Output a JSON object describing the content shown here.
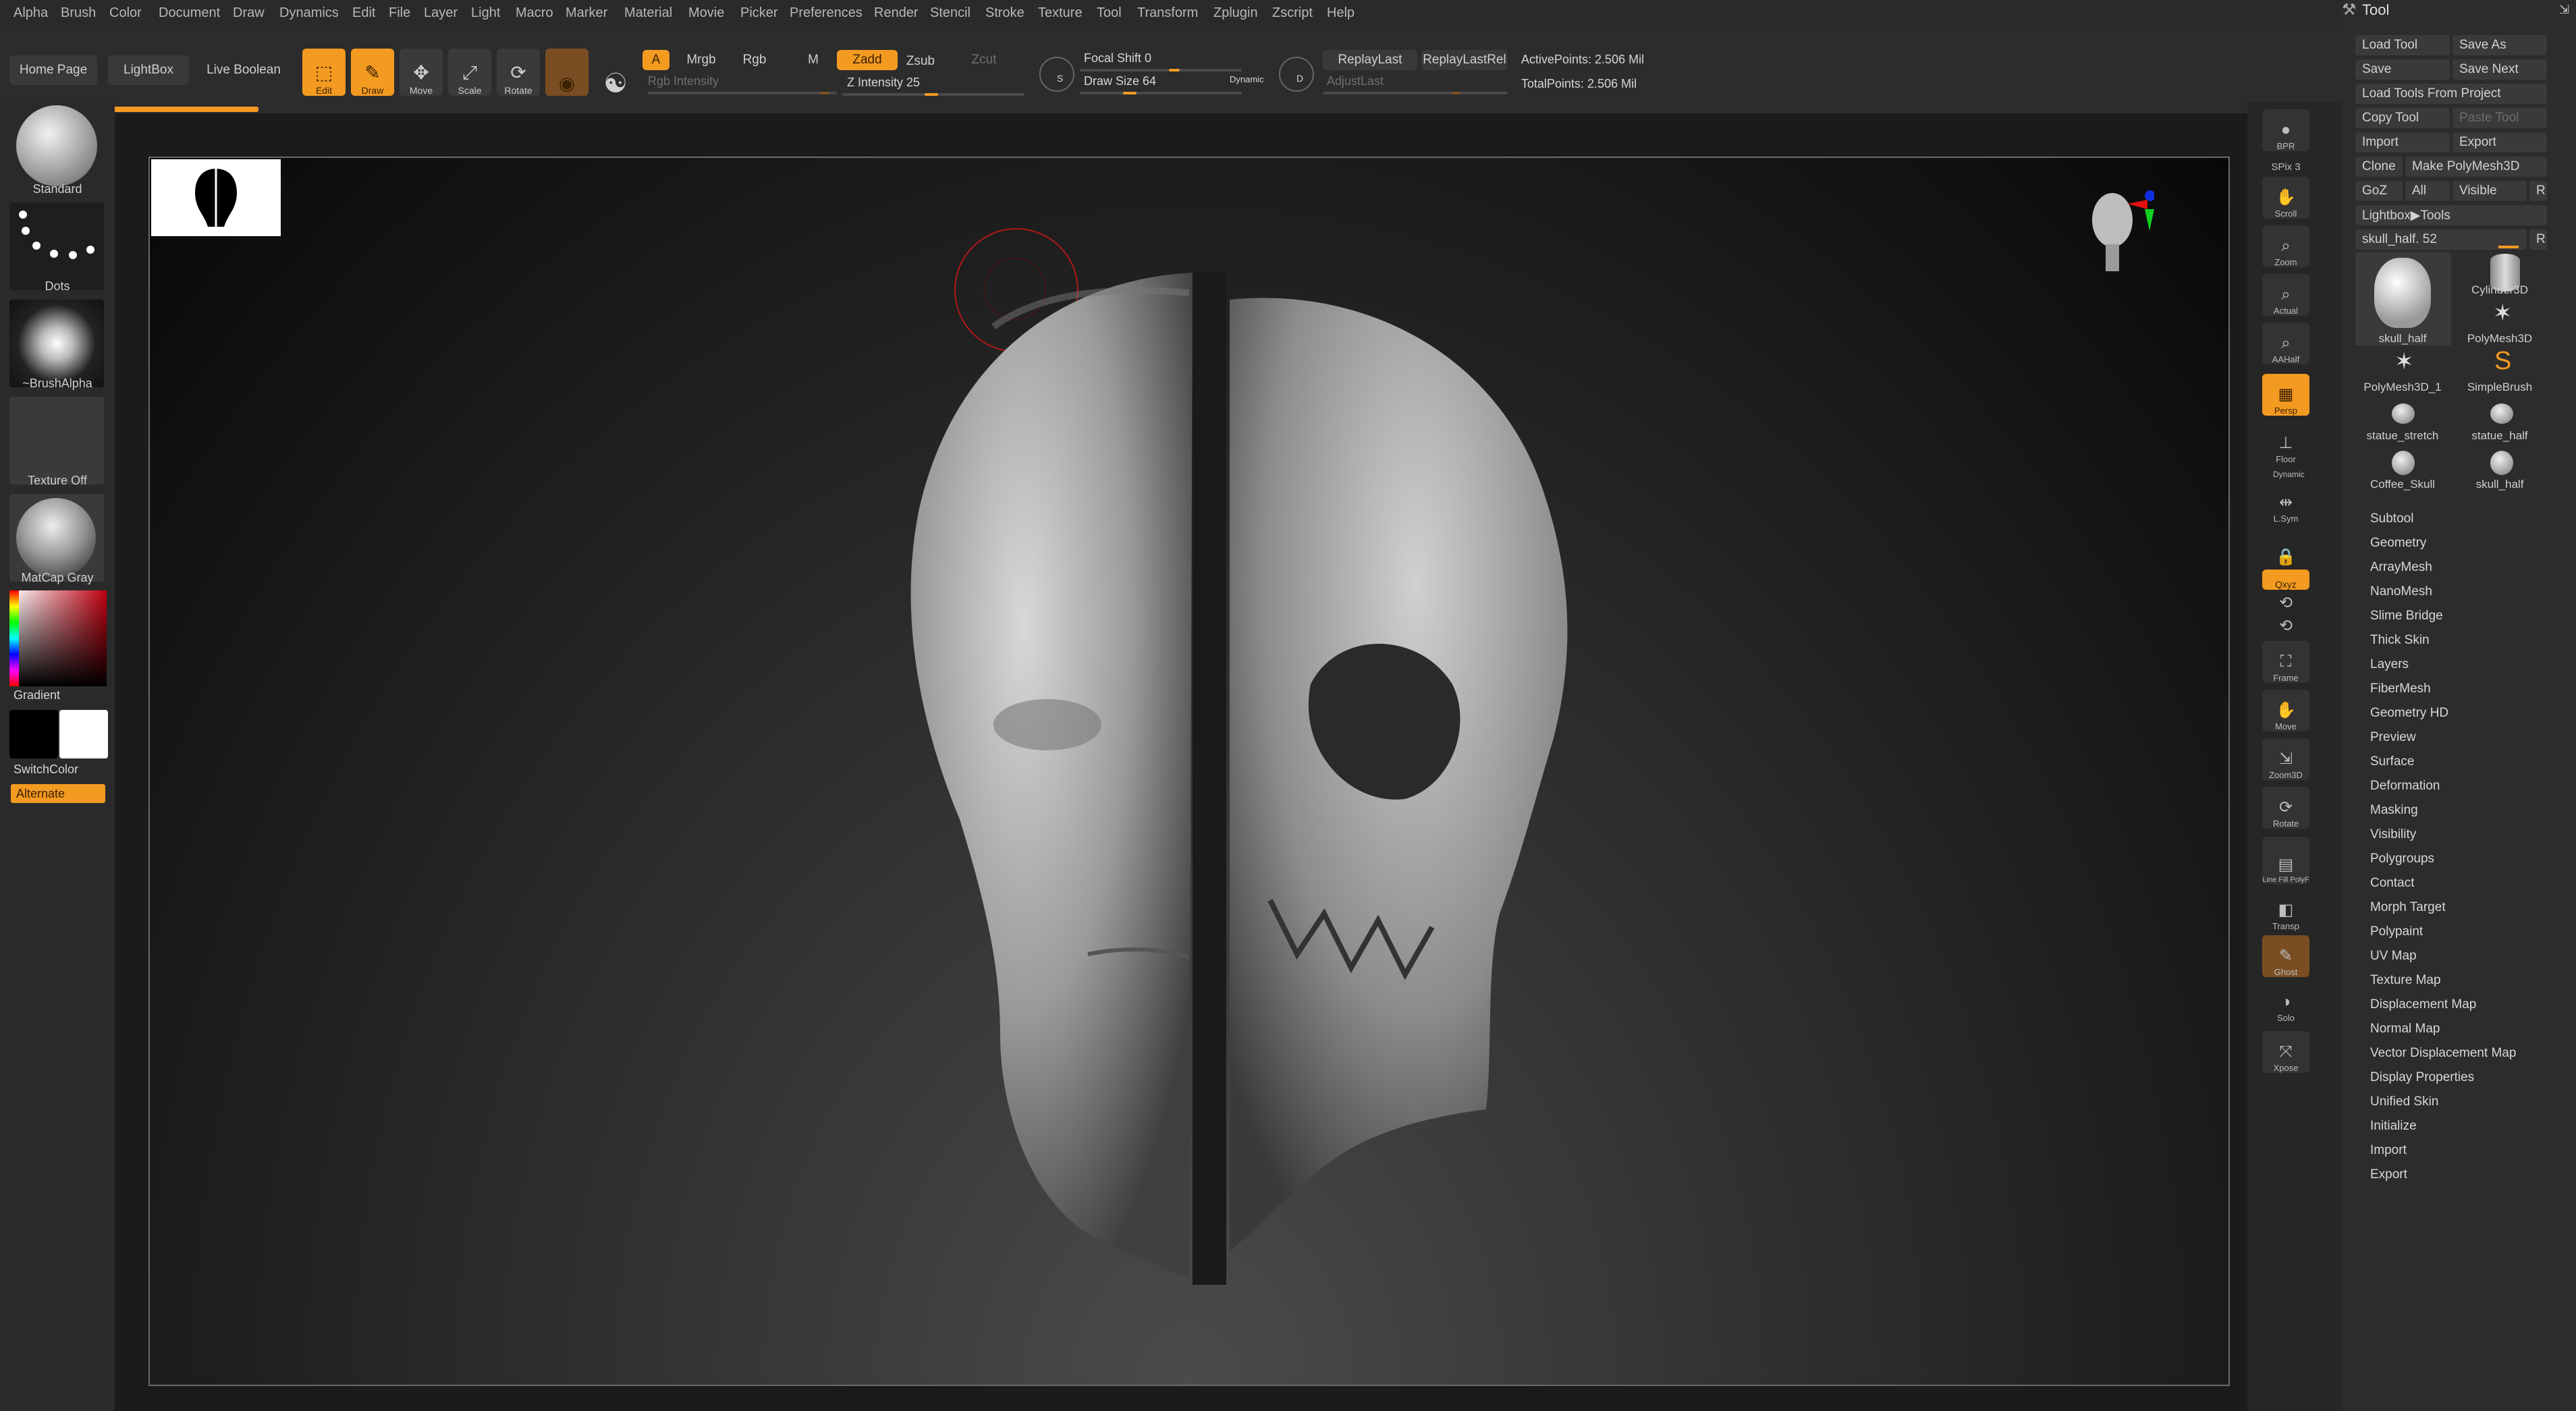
{
  "menubar": {
    "items": [
      "Alpha",
      "Brush",
      "Color",
      "Document",
      "Draw",
      "Dynamics",
      "Edit",
      "File",
      "Layer",
      "Light",
      "Macro",
      "Marker",
      "Material",
      "Movie",
      "Picker",
      "Preferences",
      "Render",
      "Stencil",
      "Stroke",
      "Texture",
      "Tool",
      "Transform",
      "Zplugin",
      "Zscript",
      "Help"
    ]
  },
  "toolbar": {
    "home_page": "Home Page",
    "lightbox": "LightBox",
    "live_boolean": "Live Boolean",
    "edit": "Edit",
    "draw": "Draw",
    "move": "Move",
    "scale": "Scale",
    "rotate": "Rotate",
    "a_label": "A",
    "mrgb": "Mrgb",
    "rgb": "Rgb",
    "m": "M",
    "zadd": "Zadd",
    "zsub": "Zsub",
    "zcut": "Zcut",
    "rgb_intensity": "Rgb Intensity",
    "z_intensity": "Z Intensity 25",
    "z_intensity_value": 25,
    "focal_shift": "Focal Shift 0",
    "focal_shift_value": 0,
    "draw_size": "Draw Size 64",
    "draw_size_value": 64,
    "dynamic": "Dynamic",
    "replay_last": "ReplayLast",
    "replay_last_rel": "ReplayLastRel",
    "adjust_last": "AdjustLast",
    "active_points": "ActivePoints: 2.506 Mil",
    "total_points": "TotalPoints: 2.506 Mil",
    "s_label": "S",
    "d_label": "D"
  },
  "left_tray": {
    "brush": "Standard",
    "stroke": "Dots",
    "alpha": "~BrushAlpha",
    "texture": "Texture Off",
    "material": "MatCap Gray",
    "gradient": "Gradient",
    "switch_color": "SwitchColor",
    "alternate": "Alternate"
  },
  "right_shelf": {
    "items": [
      "BPR",
      "SPix 3",
      "Scroll",
      "Zoom",
      "Actual",
      "AAHalf",
      "Persp",
      "Floor",
      "L.Sym",
      "",
      "Qxyz",
      "",
      "",
      "Frame",
      "Move",
      "Zoom3D",
      "Rotate",
      "Line Fill PolyF",
      "Transp",
      "Ghost",
      "Solo",
      "Xpose"
    ],
    "dynamic": "Dynamic"
  },
  "tool_panel": {
    "title": "Tool",
    "load_tool": "Load Tool",
    "save_as": "Save As",
    "save": "Save",
    "save_next": "Save Next",
    "load_tools_from_project": "Load Tools From Project",
    "copy_tool": "Copy Tool",
    "paste_tool": "Paste Tool",
    "import": "Import",
    "export": "Export",
    "clone": "Clone",
    "make_polymesh3d": "Make PolyMesh3D",
    "goz": "GoZ",
    "all": "All",
    "visible": "Visible",
    "r": "R",
    "lightbox_tools": "Lightbox▶Tools",
    "current_tool": "skull_half. 52",
    "tools": [
      "skull_half",
      "Cylinder3D",
      "PolyMesh3D",
      "PolyMesh3D_1",
      "SimpleBrush",
      "statue_stretch",
      "statue_half",
      "Coffee_Skull",
      "skull_half"
    ],
    "subpalettes": [
      "Subtool",
      "Geometry",
      "ArrayMesh",
      "NanoMesh",
      "Slime Bridge",
      "Thick Skin",
      "Layers",
      "FiberMesh",
      "Geometry HD",
      "Preview",
      "Surface",
      "Deformation",
      "Masking",
      "Visibility",
      "Polygroups",
      "Contact",
      "Morph Target",
      "Polypaint",
      "UV Map",
      "Texture Map",
      "Displacement Map",
      "Normal Map",
      "Vector Displacement Map",
      "Display Properties",
      "Unified Skin",
      "Initialize",
      "Import",
      "Export"
    ]
  },
  "colors": {
    "accent": "#f39a21",
    "panel": "#2c2c2c",
    "axis_x": "#e01010",
    "axis_y": "#10d020",
    "axis_z": "#1030e0"
  }
}
